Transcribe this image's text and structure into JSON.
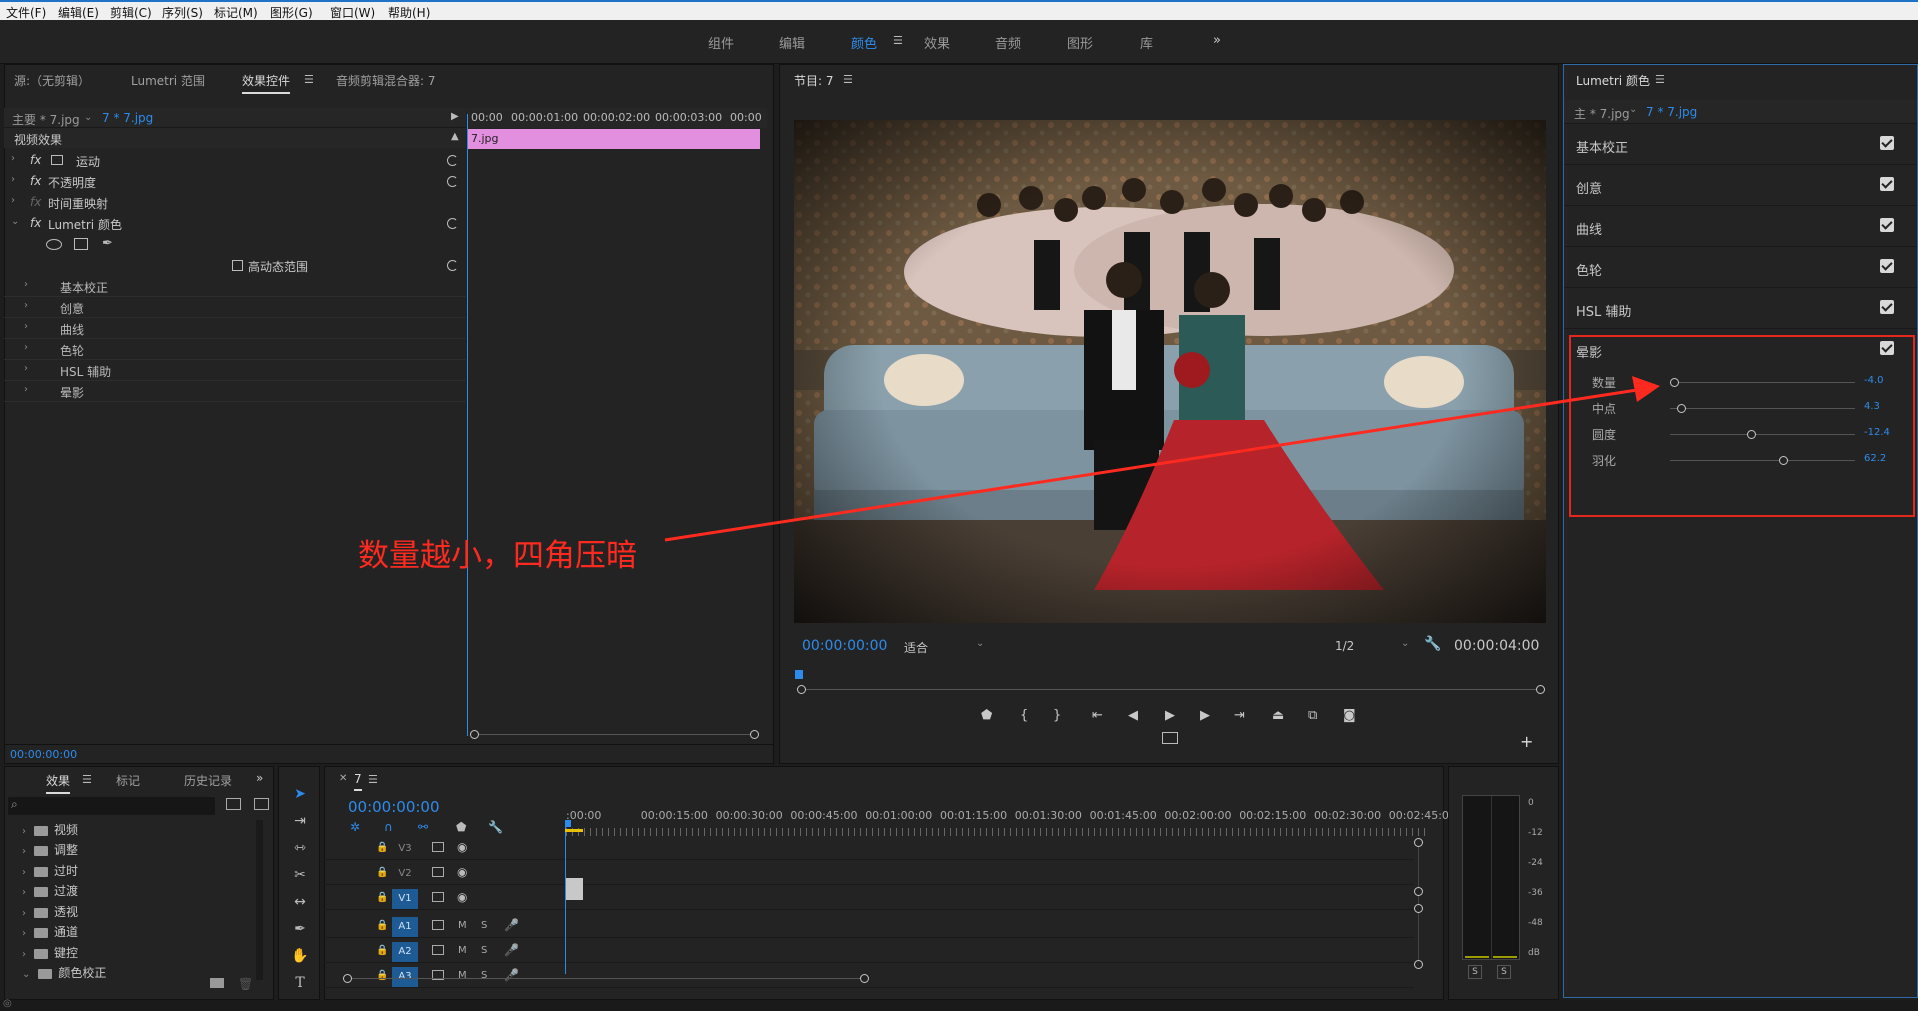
{
  "menu": [
    "文件(F)",
    "编辑(E)",
    "剪辑(C)",
    "序列(S)",
    "标记(M)",
    "图形(G)",
    "窗口(W)",
    "帮助(H)"
  ],
  "workspaces": [
    "组件",
    "编辑",
    "颜色",
    "效果",
    "音频",
    "图形",
    "库"
  ],
  "workspace_more": "»",
  "source_panel": {
    "tabs": [
      "源:（无剪辑）",
      "Lumetri 范围",
      "效果控件",
      "音频剪辑混合器: 7"
    ],
    "master": "主要 * 7.jpg",
    "clip": "7 * 7.jpg",
    "section": "视频效果",
    "effects": [
      "运动",
      "不透明度",
      "时间重映射",
      "Lumetri 颜色"
    ],
    "hdr": "高动态范围",
    "sub_items": [
      "基本校正",
      "创意",
      "曲线",
      "色轮",
      "HSL 辅助",
      "晕影"
    ],
    "ruler": [
      "00:00",
      "00:00:01:00",
      "00:00:02:00",
      "00:00:03:00",
      "00:00"
    ],
    "clip_label": "7.jpg",
    "timecode": "00:00:00:00",
    "fx": "fx"
  },
  "program": {
    "title": "节目: 7",
    "timecode": "00:00:00:00",
    "fit": "适合",
    "resolution": "1/2",
    "duration": "00:00:04:00"
  },
  "lumetri": {
    "title": "Lumetri 颜色",
    "master": "主 * 7.jpg",
    "clip": "7 * 7.jpg",
    "sections": [
      "基本校正",
      "创意",
      "曲线",
      "色轮",
      "HSL 辅助",
      "晕影"
    ],
    "vignette": [
      {
        "label": "数量",
        "value": "-4.0",
        "pos": 0.0
      },
      {
        "label": "中点",
        "value": "4.3",
        "pos": 0.04
      },
      {
        "label": "圆度",
        "value": "-12.4",
        "pos": 0.44
      },
      {
        "label": "羽化",
        "value": "62.2",
        "pos": 0.62
      }
    ]
  },
  "annotation": "数量越小，四角压暗",
  "effects_panel": {
    "tabs": [
      "效果",
      "标记",
      "历史记录"
    ],
    "folders": [
      "视频",
      "调整",
      "过时",
      "过渡",
      "透视",
      "通道",
      "键控",
      "颜色校正"
    ]
  },
  "timeline": {
    "tab": "7",
    "timecode": "00:00:00:00",
    "ruler": [
      ":00:00",
      "00:00:15:00",
      "00:00:30:00",
      "00:00:45:00",
      "00:01:00:00",
      "00:01:15:00",
      "00:01:30:00",
      "00:01:45:00",
      "00:02:00:00",
      "00:02:15:00",
      "00:02:30:00",
      "00:02:45:00"
    ],
    "tracks": [
      "V3",
      "V2",
      "V1",
      "A1",
      "A2",
      "A3"
    ],
    "m": "M",
    "s": "S"
  },
  "meter": {
    "scale": [
      "0",
      "-12",
      "-24",
      "-36",
      "-48",
      "dB"
    ],
    "solo": "S"
  },
  "colors": {
    "accent": "#2d8ceb",
    "clip": "#e38fe0",
    "annotation": "#ff2a1f"
  }
}
